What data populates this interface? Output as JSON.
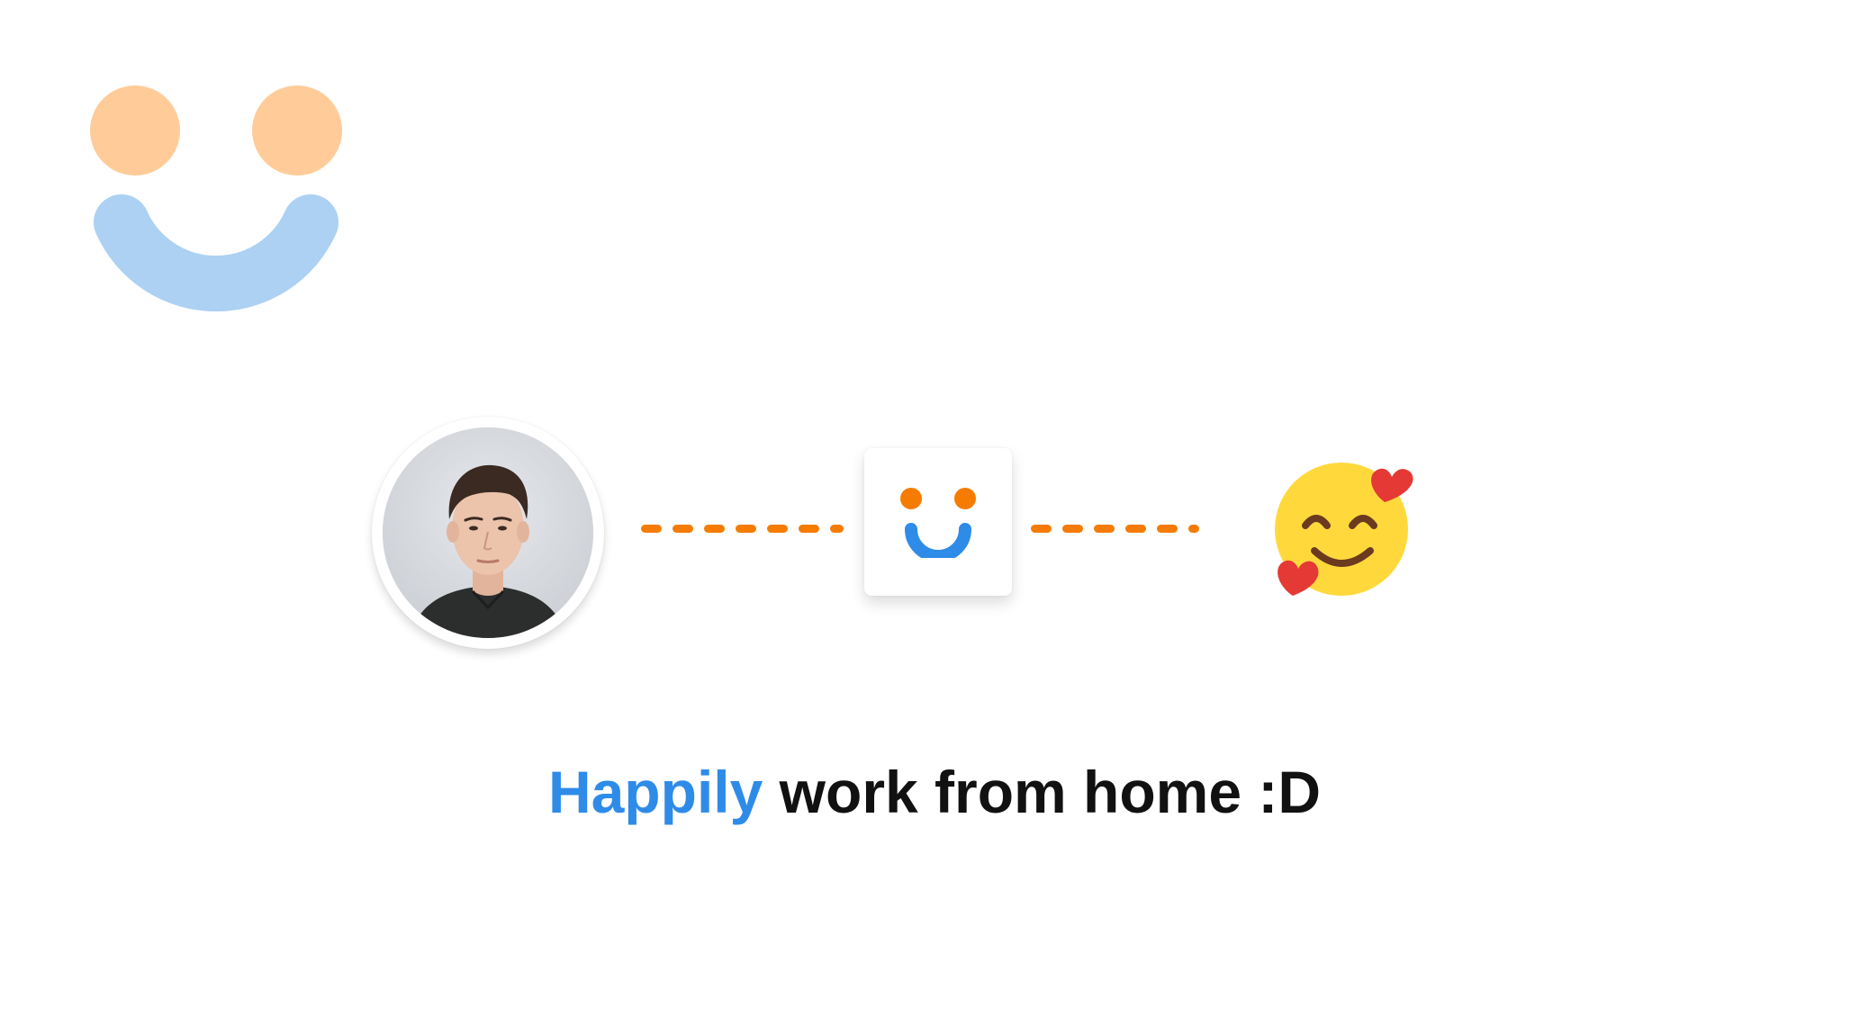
{
  "headline": {
    "highlight": "Happily",
    "rest": " work from home :D"
  },
  "icons": {
    "brand_logo": "smiley-logo-icon",
    "app_tile": "app-smiley-icon",
    "emoji": "smiling-face-with-hearts-icon"
  },
  "colors": {
    "logo_eyes": "#ffcc99",
    "logo_mouth": "#acd1f3",
    "accent_blue": "#2f8be8",
    "accent_orange": "#f57c00",
    "emoji_face": "#ffd93b",
    "emoji_heart": "#e53935"
  }
}
